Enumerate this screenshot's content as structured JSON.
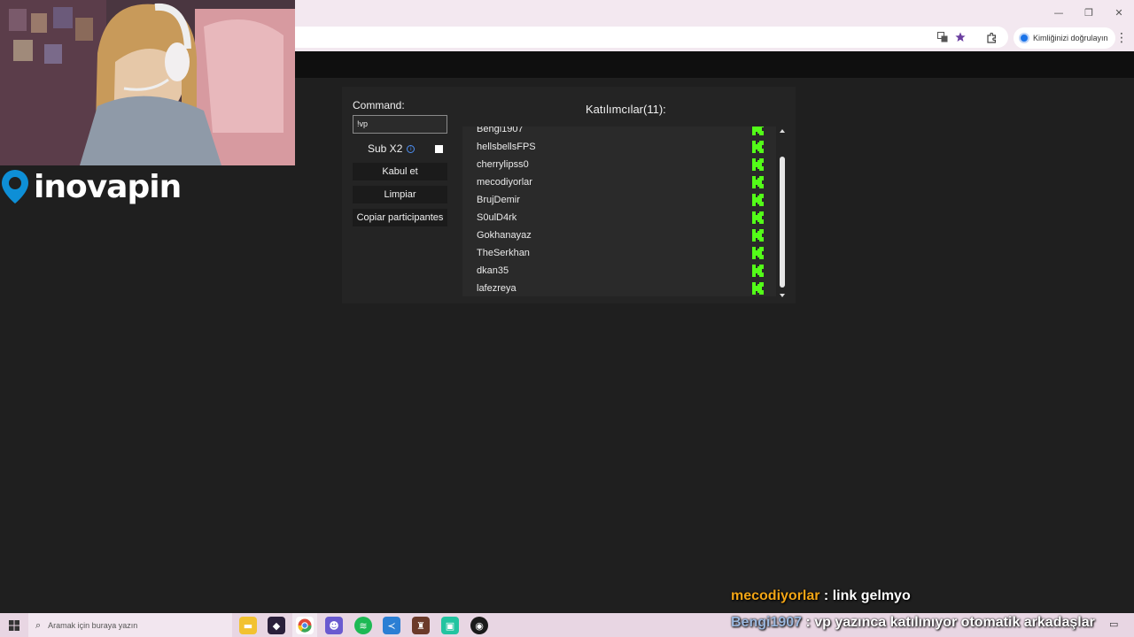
{
  "browser": {
    "profile_label": "Kimliğinizi doğrulayın",
    "window_controls": [
      "—",
      "❐",
      "✕"
    ],
    "icons": [
      "translate-icon",
      "star-icon",
      "extensions-icon",
      "menu-dots-icon"
    ]
  },
  "panel": {
    "command_label": "Command:",
    "command_value": "!vp",
    "sub_label": "Sub X2",
    "sub_checked": false,
    "buttons": {
      "accept": "Kabul et",
      "clear": "Limpiar",
      "copy": "Copiar participantes"
    }
  },
  "participants": {
    "title": "Katılımcılar(11):",
    "items": [
      "Bengi1907",
      "hellsbellsFPS",
      "cherrylipss0",
      "mecodiyorlar",
      "BrujDemir",
      "S0ulD4rk",
      "Gokhanayaz",
      "TheSerkhan",
      "dkan35",
      "lafezreya"
    ],
    "kick_color": "#53fc18"
  },
  "overlay": {
    "logo_text": "inovapin",
    "chat": [
      {
        "user": "mecodiyorlar",
        "message": " : link gelmyo"
      },
      {
        "user": "Bengi1907",
        "message": " : vp yazınca katılınıyor otomatik arkadaşlar"
      }
    ]
  },
  "taskbar": {
    "search_placeholder": "Aramak için buraya yazın",
    "apps": [
      "file-explorer",
      "app-dark",
      "chrome",
      "discord",
      "spotify",
      "vscode",
      "game-app",
      "app-teal",
      "obs"
    ]
  }
}
